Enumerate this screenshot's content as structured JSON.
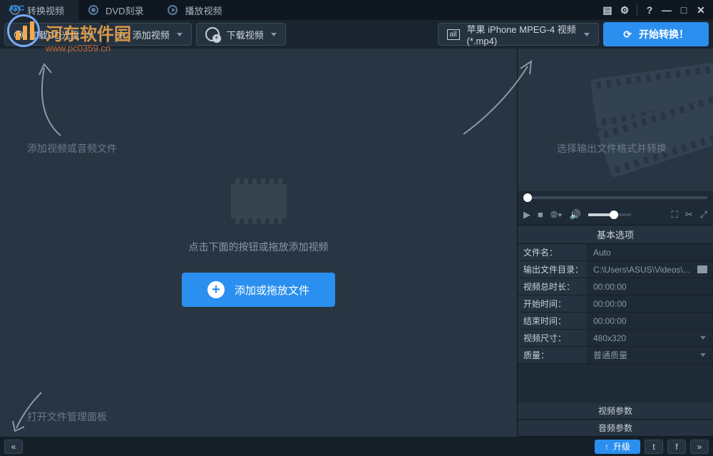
{
  "watermark": {
    "title": "河东软件园",
    "url": "www.pc0359.cn",
    "avc": "AVC"
  },
  "tabs": {
    "convert": "转换视频",
    "dvd": "DVD刻录",
    "play": "播放视频"
  },
  "titlebar_icons": {
    "settings": "⚙",
    "help": "?",
    "minimize": "—",
    "maximize": "□",
    "close": "✕",
    "menu": "▤"
  },
  "toolbar": {
    "load_cd": "加载CD光盘",
    "add_video": "添加视频",
    "download_video": "下载视频",
    "output_format": "苹果 iPhone MPEG-4 视频 (*.mp4)",
    "output_prefix": "all",
    "start": "开始转换！"
  },
  "hints": {
    "add_file": "添加视频或音频文件",
    "select_output": "选择输出文件格式并转换",
    "open_panel": "打开文件管理面板"
  },
  "placeholder": {
    "text": "点击下面的按钮或拖放添加视频",
    "button": "添加或拖放文件"
  },
  "player_icons": {
    "play": "▶",
    "stop": "■",
    "camera": "◉",
    "volume": "🔊",
    "link": "⛶",
    "cut": "✂",
    "expand": "⤢"
  },
  "options": {
    "title": "基本选项",
    "rows": [
      {
        "label": "文件名：",
        "value": "Auto",
        "type": "text"
      },
      {
        "label": "输出文件目录：",
        "value": "C:\\Users\\ASUS\\Videos\\...",
        "type": "folder"
      },
      {
        "label": "视频总时长：",
        "value": "00:00:00",
        "type": "text"
      },
      {
        "label": "开始时间：",
        "value": "00:00:00",
        "type": "text"
      },
      {
        "label": "结束时间：",
        "value": "00:00:00",
        "type": "text"
      },
      {
        "label": "视频尺寸：",
        "value": "480x320",
        "type": "drop"
      },
      {
        "label": "质量：",
        "value": "普通质量",
        "type": "drop"
      }
    ],
    "video_params": "视频参数",
    "audio_params": "音频参数"
  },
  "statusbar": {
    "collapse": "«",
    "upgrade": "升级",
    "up": "↑",
    "twitter": "t",
    "facebook": "f",
    "expand": "»"
  }
}
